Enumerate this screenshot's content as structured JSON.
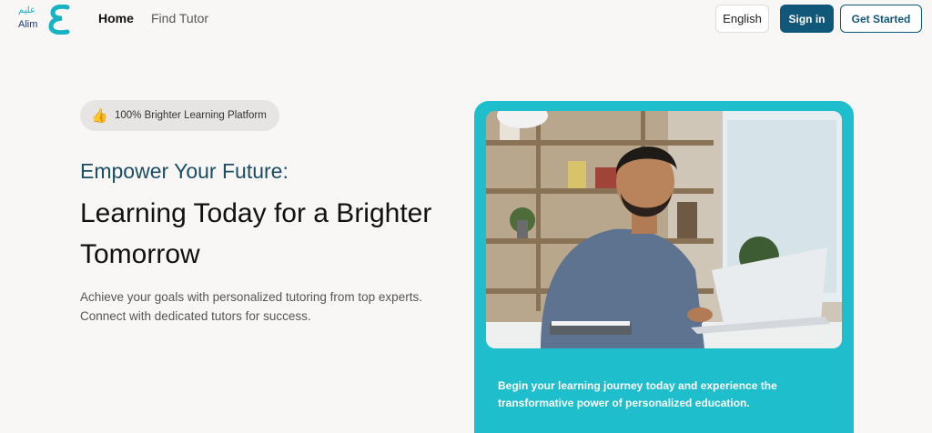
{
  "header": {
    "logo_ar": "عليم",
    "logo_en": "Alim",
    "nav": [
      {
        "label": "Home",
        "active": true
      },
      {
        "label": "Find Tutor",
        "active": false
      }
    ],
    "language_button": "English",
    "signin_button": "Sign in",
    "get_started_button": "Get Started"
  },
  "hero": {
    "badge_icon": "thumbs-up-icon",
    "badge_emoji": "👍",
    "badge_text": "100% Brighter Learning Platform",
    "eyebrow": "Empower Your Future:",
    "title": "Learning Today for a Brighter Tomorrow",
    "description": "Achieve your goals with personalized tutoring from top experts. Connect with dedicated tutors for success.",
    "card_text": "Begin your learning journey today and experience the transformative power of personalized education."
  },
  "colors": {
    "accent": "#1ebecd",
    "primary": "#11577a",
    "heading_teal": "#1b4d63"
  }
}
